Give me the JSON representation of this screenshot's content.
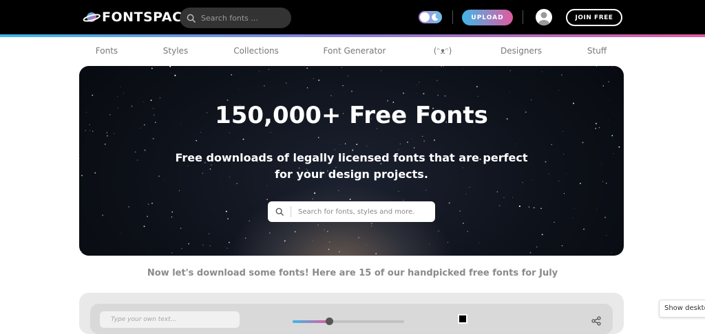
{
  "header": {
    "logo_text": "FONTSPACE",
    "search_placeholder": "Search fonts ...",
    "upload_label": "UPLOAD",
    "join_label": "JOIN FREE"
  },
  "nav": {
    "items": [
      {
        "label": "Fonts"
      },
      {
        "label": "Styles"
      },
      {
        "label": "Collections"
      },
      {
        "label": "Font Generator"
      },
      {
        "label": "(ᵔᴥᵔ)"
      },
      {
        "label": "Designers"
      },
      {
        "label": "Stuff"
      }
    ]
  },
  "hero": {
    "title": "150,000+ Free Fonts",
    "subtitle": "Free downloads of legally licensed fonts that are perfect for your design projects.",
    "search_placeholder": "Search for fonts, styles and more."
  },
  "tagline": "Now let's download some fonts! Here are 15 of our handpicked free fonts for July",
  "preview": {
    "text_placeholder": "Type your own text...",
    "size_slider_fraction": 0.33,
    "color": "#000000"
  },
  "desktop_button_label": "Show desktop",
  "colors": {
    "accent_blue": "#3fb7e8",
    "accent_pink": "#e25aa0",
    "header_bg": "#000000"
  }
}
